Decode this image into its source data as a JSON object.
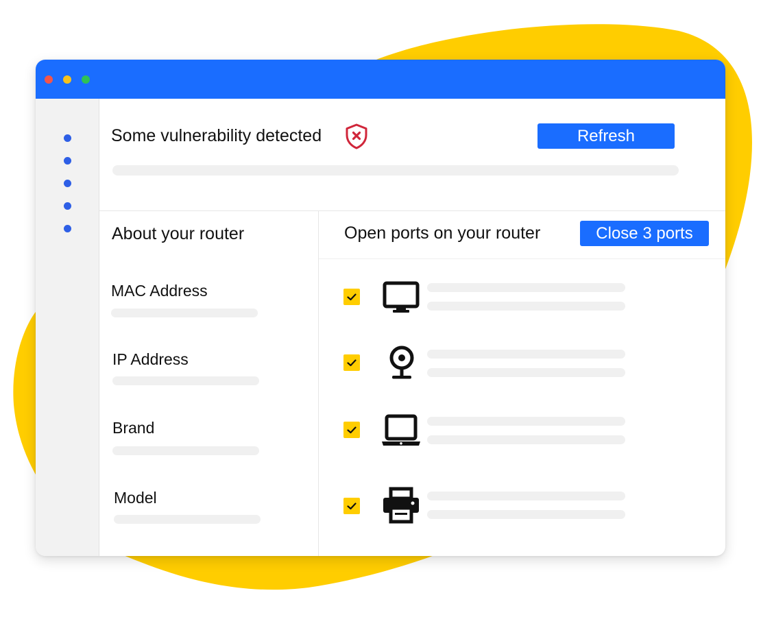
{
  "colors": {
    "accent": "#1a6dff",
    "blob": "#ffcd00",
    "danger": "#d0263a",
    "check": "#ffcd00",
    "window_dots": [
      "#f3554b",
      "#f6c21d",
      "#2fc255"
    ],
    "nav_dot": "#2e5fe6"
  },
  "header": {
    "status_title": "Some vulnerability detected",
    "status_icon": "shield-x-icon",
    "refresh_label": "Refresh"
  },
  "router": {
    "title": "About your router",
    "fields": [
      {
        "label": "MAC Address"
      },
      {
        "label": "IP Address"
      },
      {
        "label": "Brand"
      },
      {
        "label": "Model"
      }
    ]
  },
  "ports": {
    "title": "Open ports on your router",
    "close_label": "Close 3 ports",
    "devices": [
      {
        "icon": "monitor-icon",
        "checked": true
      },
      {
        "icon": "webcam-icon",
        "checked": true
      },
      {
        "icon": "laptop-icon",
        "checked": true
      },
      {
        "icon": "printer-icon",
        "checked": true
      }
    ]
  }
}
